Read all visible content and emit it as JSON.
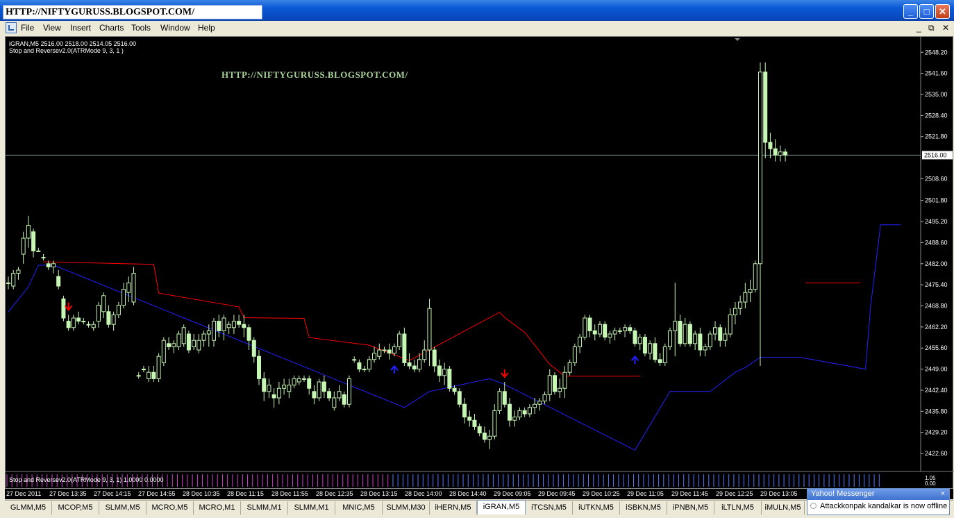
{
  "window": {
    "title": "HTTP://NIFTYGURUSS.BLOGSPOT.COM/",
    "controls": {
      "minimize": "_",
      "maximize": "□",
      "close": "✕"
    }
  },
  "menu": [
    "File",
    "View",
    "Insert",
    "Charts",
    "Tools",
    "Window",
    "Help"
  ],
  "mdi": {
    "minimize": "_",
    "restore": "⧉",
    "close": "✕"
  },
  "chart": {
    "info_line": "iGRAN,M5  2516.00 2518.00 2514.05 2516.00",
    "indicator_line": "Stop and Reversev2.0(ATRMode 9, 3, 1 )",
    "watermark": "HTTP://NIFTYGURUSS.BLOGSPOT.COM/",
    "subwindow_label": "Stop and Reversev2.0(ATRMode 9, 3, 1) 1.0000 0.0000",
    "subwindow_ticks": [
      "1.05",
      "0.00"
    ],
    "current_price_label": "2516.00",
    "colors": {
      "bull": "#c7f7b5",
      "stop_down": "#ff0000",
      "stop_up": "#2222ff",
      "price_line": "#8aa0a0"
    }
  },
  "chart_data": {
    "type": "candlestick",
    "symbol": "iGRAN,M5",
    "ylim": [
      2420,
      2550
    ],
    "y_ticks": [
      2548.2,
      2541.6,
      2535.0,
      2528.4,
      2521.8,
      2516.0,
      2508.6,
      2501.8,
      2495.2,
      2488.6,
      2482.0,
      2475.4,
      2468.8,
      2462.2,
      2455.6,
      2449.0,
      2442.4,
      2435.8,
      2429.2,
      2422.6
    ],
    "x_labels": [
      "27 Dec 2011",
      "27 Dec 13:35",
      "27 Dec 14:15",
      "27 Dec 14:55",
      "28 Dec 10:35",
      "28 Dec 11:15",
      "28 Dec 11:55",
      "28 Dec 12:35",
      "28 Dec 13:15",
      "28 Dec 14:00",
      "28 Dec 14:40",
      "29 Dec 09:05",
      "29 Dec 09:45",
      "29 Dec 10:25",
      "29 Dec 11:05",
      "29 Dec 11:45",
      "29 Dec 12:25",
      "29 Dec 13:05"
    ],
    "current_price": 2516.0,
    "ohlc": [
      [
        2476,
        2478,
        2474,
        2476
      ],
      [
        2475,
        2480,
        2474,
        2479
      ],
      [
        2479,
        2481,
        2477,
        2480
      ],
      [
        2485,
        2492,
        2482,
        2490
      ],
      [
        2490,
        2497,
        2487,
        2494
      ],
      [
        2492,
        2493,
        2484,
        2486
      ],
      [
        2486,
        2487,
        2486,
        2486
      ],
      [
        2484,
        2485,
        2483,
        2484
      ],
      [
        2482,
        2483,
        2480,
        2481
      ],
      [
        2481,
        2483,
        2479,
        2482
      ],
      [
        2478,
        2480,
        2474,
        2475
      ],
      [
        2471,
        2472,
        2464,
        2465
      ],
      [
        2464,
        2466,
        2461,
        2462
      ],
      [
        2462,
        2466,
        2461,
        2465
      ],
      [
        2465,
        2467,
        2463,
        2464
      ],
      [
        2464,
        2465,
        2463,
        2464
      ],
      [
        2463,
        2464,
        2462,
        2463
      ],
      [
        2462,
        2464,
        2461,
        2463
      ],
      [
        2464,
        2470,
        2462,
        2469
      ],
      [
        2467,
        2473,
        2465,
        2472
      ],
      [
        2467,
        2469,
        2462,
        2463
      ],
      [
        2463,
        2467,
        2461,
        2466
      ],
      [
        2466,
        2470,
        2465,
        2469
      ],
      [
        2469,
        2476,
        2468,
        2474
      ],
      [
        2473,
        2478,
        2470,
        2476
      ],
      [
        2470,
        2481,
        2469,
        2479
      ],
      [
        2447,
        2448,
        2446,
        2447
      ],
      [
        2449,
        2450,
        2448,
        2449
      ],
      [
        2446,
        2450,
        2445,
        2448
      ],
      [
        2448,
        2450,
        2445,
        2446
      ],
      [
        2446,
        2454,
        2445,
        2453
      ],
      [
        2451,
        2459,
        2450,
        2458
      ],
      [
        2457,
        2459,
        2455,
        2456
      ],
      [
        2456,
        2458,
        2454,
        2457
      ],
      [
        2456,
        2461,
        2455,
        2460
      ],
      [
        2457,
        2463,
        2456,
        2462
      ],
      [
        2460,
        2461,
        2454,
        2455
      ],
      [
        2456,
        2460,
        2455,
        2458
      ],
      [
        2455,
        2460,
        2454,
        2458
      ],
      [
        2458,
        2461,
        2456,
        2460
      ],
      [
        2460,
        2463,
        2456,
        2461
      ],
      [
        2458,
        2465,
        2456,
        2464
      ],
      [
        2464,
        2466,
        2459,
        2461
      ],
      [
        2461,
        2466,
        2458,
        2465
      ],
      [
        2462,
        2464,
        2460,
        2463
      ],
      [
        2462,
        2466,
        2460,
        2464
      ],
      [
        2464,
        2466,
        2462,
        2463
      ],
      [
        2463,
        2466,
        2459,
        2462
      ],
      [
        2462,
        2463,
        2455,
        2458
      ],
      [
        2458,
        2459,
        2451,
        2453
      ],
      [
        2453,
        2455,
        2444,
        2446
      ],
      [
        2446,
        2448,
        2439,
        2442
      ],
      [
        2442,
        2446,
        2440,
        2444
      ],
      [
        2441,
        2443,
        2437,
        2440
      ],
      [
        2440,
        2445,
        2438,
        2443
      ],
      [
        2443,
        2446,
        2441,
        2444
      ],
      [
        2442,
        2446,
        2440,
        2444
      ],
      [
        2444,
        2447,
        2443,
        2446
      ],
      [
        2445,
        2447,
        2444,
        2446
      ],
      [
        2446,
        2447,
        2445,
        2446
      ],
      [
        2446,
        2447,
        2441,
        2443
      ],
      [
        2442,
        2444,
        2438,
        2440
      ],
      [
        2440,
        2446,
        2439,
        2445
      ],
      [
        2445,
        2447,
        2440,
        2442
      ],
      [
        2442,
        2443,
        2439,
        2440
      ],
      [
        2437,
        2442,
        2436,
        2440
      ],
      [
        2440,
        2444,
        2439,
        2442
      ],
      [
        2441,
        2442,
        2437,
        2438
      ],
      [
        2438,
        2447,
        2437,
        2446
      ],
      [
        2452,
        2453,
        2451,
        2452
      ],
      [
        2451,
        2452,
        2448,
        2449
      ],
      [
        2449,
        2450,
        2448,
        2449
      ],
      [
        2449,
        2453,
        2448,
        2452
      ],
      [
        2452,
        2456,
        2451,
        2454
      ],
      [
        2453,
        2457,
        2452,
        2455
      ],
      [
        2455,
        2456,
        2454,
        2455
      ],
      [
        2455,
        2457,
        2452,
        2454
      ],
      [
        2454,
        2457,
        2453,
        2456
      ],
      [
        2456,
        2461,
        2455,
        2460
      ],
      [
        2460,
        2462,
        2450,
        2451
      ],
      [
        2451,
        2454,
        2449,
        2450
      ],
      [
        2450,
        2452,
        2448,
        2449
      ],
      [
        2449,
        2454,
        2448,
        2452
      ],
      [
        2452,
        2458,
        2451,
        2455
      ],
      [
        2455,
        2471,
        2450,
        2468
      ],
      [
        2455,
        2456,
        2448,
        2450
      ],
      [
        2450,
        2452,
        2445,
        2447
      ],
      [
        2447,
        2451,
        2444,
        2449
      ],
      [
        2449,
        2450,
        2442,
        2443
      ],
      [
        2443,
        2444,
        2441,
        2442
      ],
      [
        2442,
        2443,
        2437,
        2438
      ],
      [
        2438,
        2440,
        2432,
        2434
      ],
      [
        2434,
        2436,
        2431,
        2433
      ],
      [
        2433,
        2435,
        2430,
        2431
      ],
      [
        2431,
        2432,
        2428,
        2429
      ],
      [
        2429,
        2431,
        2426,
        2427
      ],
      [
        2427,
        2430,
        2424,
        2428
      ],
      [
        2428,
        2438,
        2427,
        2436
      ],
      [
        2436,
        2443,
        2435,
        2442
      ],
      [
        2442,
        2445,
        2437,
        2438
      ],
      [
        2438,
        2440,
        2431,
        2433
      ],
      [
        2433,
        2436,
        2431,
        2434
      ],
      [
        2434,
        2437,
        2433,
        2436
      ],
      [
        2436,
        2437,
        2434,
        2435
      ],
      [
        2435,
        2438,
        2434,
        2437
      ],
      [
        2437,
        2440,
        2435,
        2438
      ],
      [
        2438,
        2440,
        2436,
        2439
      ],
      [
        2439,
        2442,
        2438,
        2441
      ],
      [
        2441,
        2449,
        2439,
        2447
      ],
      [
        2447,
        2448,
        2441,
        2442
      ],
      [
        2442,
        2446,
        2440,
        2443
      ],
      [
        2443,
        2450,
        2440,
        2448
      ],
      [
        2448,
        2452,
        2447,
        2451
      ],
      [
        2451,
        2457,
        2450,
        2456
      ],
      [
        2456,
        2460,
        2454,
        2459
      ],
      [
        2459,
        2466,
        2458,
        2465
      ],
      [
        2465,
        2466,
        2459,
        2461
      ],
      [
        2461,
        2463,
        2458,
        2460
      ],
      [
        2460,
        2464,
        2459,
        2463
      ],
      [
        2463,
        2464,
        2458,
        2459
      ],
      [
        2459,
        2461,
        2457,
        2460
      ],
      [
        2460,
        2462,
        2458,
        2461
      ],
      [
        2461,
        2462,
        2460,
        2461
      ],
      [
        2461,
        2463,
        2459,
        2462
      ],
      [
        2462,
        2463,
        2460,
        2461
      ],
      [
        2461,
        2462,
        2456,
        2457
      ],
      [
        2457,
        2460,
        2455,
        2459
      ],
      [
        2459,
        2460,
        2453,
        2454
      ],
      [
        2454,
        2458,
        2452,
        2457
      ],
      [
        2457,
        2459,
        2451,
        2452
      ],
      [
        2452,
        2454,
        2450,
        2451
      ],
      [
        2451,
        2457,
        2450,
        2456
      ],
      [
        2456,
        2462,
        2455,
        2461
      ],
      [
        2461,
        2476,
        2453,
        2464
      ],
      [
        2464,
        2466,
        2456,
        2457
      ],
      [
        2457,
        2465,
        2456,
        2463
      ],
      [
        2463,
        2464,
        2456,
        2457
      ],
      [
        2457,
        2461,
        2455,
        2460
      ],
      [
        2460,
        2462,
        2453,
        2455
      ],
      [
        2455,
        2457,
        2453,
        2456
      ],
      [
        2456,
        2461,
        2455,
        2460
      ],
      [
        2460,
        2464,
        2458,
        2462
      ],
      [
        2462,
        2463,
        2456,
        2458
      ],
      [
        2458,
        2462,
        2456,
        2460
      ],
      [
        2460,
        2468,
        2459,
        2466
      ],
      [
        2466,
        2470,
        2463,
        2468
      ],
      [
        2468,
        2472,
        2466,
        2470
      ],
      [
        2470,
        2476,
        2468,
        2473
      ],
      [
        2473,
        2477,
        2470,
        2474
      ],
      [
        2474,
        2483,
        2473,
        2482
      ],
      [
        2482,
        2545,
        2450,
        2542
      ],
      [
        2542,
        2545,
        2515,
        2520
      ],
      [
        2520,
        2523,
        2515,
        2518
      ],
      [
        2518,
        2521,
        2514,
        2516
      ],
      [
        2516,
        2519,
        2514,
        2517
      ],
      [
        2517,
        2518,
        2514,
        2516
      ]
    ],
    "series": [
      {
        "name": "Stop and Reversev2.0 (down)",
        "color": "#ff0000",
        "points": [
          [
            7,
            2482.6
          ],
          [
            29,
            2481.8
          ],
          [
            30,
            2472.8
          ],
          [
            46,
            2468.5
          ],
          [
            47,
            2465.1
          ],
          [
            59,
            2464.9
          ],
          [
            60,
            2458.9
          ],
          [
            72,
            2456.5
          ],
          [
            80,
            2451.7
          ],
          [
            98,
            2466.8
          ],
          [
            99,
            2465.2
          ],
          [
            103,
            2460.5
          ],
          [
            108,
            2450.5
          ],
          [
            111,
            2446.8
          ],
          [
            126,
            2446.8
          ]
        ]
      },
      {
        "name": "Stop and Reversev2.0 (up)",
        "color": "#2222ff",
        "points": [
          [
            0,
            2466.9
          ],
          [
            4,
            2474.8
          ],
          [
            6,
            2481.5
          ],
          [
            9,
            2481.6
          ],
          [
            79,
            2437.0
          ],
          [
            84,
            2442.0
          ],
          [
            96,
            2446.0
          ],
          [
            99,
            2444.2
          ],
          [
            125,
            2423.6
          ],
          [
            132,
            2442.0
          ],
          [
            140,
            2442.0
          ],
          [
            145,
            2448.0
          ],
          [
            147,
            2449.5
          ],
          [
            150,
            2452.7
          ],
          [
            158,
            2452.7
          ],
          [
            171,
            2449.0
          ],
          [
            172,
            2468.5
          ],
          [
            174,
            2494.2
          ],
          [
            178,
            2494.2
          ]
        ]
      },
      {
        "name": "Stop and Reversev2.0 (down, late)",
        "color": "#ff0000",
        "points": [
          [
            159,
            2476.0
          ],
          [
            170,
            2476.0
          ]
        ]
      }
    ],
    "arrows": [
      {
        "index": 12,
        "direction": "down",
        "color": "#ff0000"
      },
      {
        "index": 77,
        "direction": "up",
        "color": "#2222ff"
      },
      {
        "index": 99,
        "direction": "down",
        "color": "#ff0000"
      },
      {
        "index": 125,
        "direction": "up",
        "color": "#2222ff"
      }
    ],
    "subwindow": {
      "levels": [
        1.0,
        0.0
      ],
      "ylim": [
        0.0,
        1.05
      ],
      "bars": "magenta-then-blue",
      "switch_index": 77
    }
  },
  "tabs": [
    {
      "label": "GLMM,M5",
      "active": false
    },
    {
      "label": "MCOP,M5",
      "active": false
    },
    {
      "label": "SLMM,M5",
      "active": false
    },
    {
      "label": "MCRO,M5",
      "active": false
    },
    {
      "label": "MCRO,M1",
      "active": false
    },
    {
      "label": "SLMM,M1",
      "active": false
    },
    {
      "label": "SLMM,M1",
      "active": false
    },
    {
      "label": "MNIC,M5",
      "active": false
    },
    {
      "label": "SLMM,M30",
      "active": false
    },
    {
      "label": "iHERN,M5",
      "active": false
    },
    {
      "label": "iGRAN,M5",
      "active": true
    },
    {
      "label": "iTCSN,M5",
      "active": false
    },
    {
      "label": "iUTKN,M5",
      "active": false
    },
    {
      "label": "iSBKN,M5",
      "active": false
    },
    {
      "label": "iPNBN,M5",
      "active": false
    },
    {
      "label": "iLTLN,M5",
      "active": false
    },
    {
      "label": "iMULN,M5",
      "active": false
    }
  ],
  "yahoo": {
    "title": "Yahoo! Messenger",
    "close": "×",
    "message": "Attackkonpak kandalkar is now offline"
  }
}
